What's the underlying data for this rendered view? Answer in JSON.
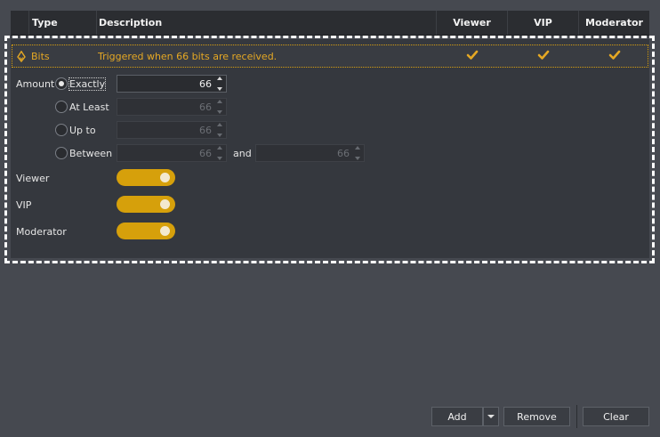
{
  "columns": {
    "type": "Type",
    "description": "Description",
    "viewer": "Viewer",
    "vip": "VIP",
    "moderator": "Moderator"
  },
  "row": {
    "type": "Bits",
    "description": "Triggered when 66 bits are received.",
    "icon": "bits-diamond-icon",
    "viewer_checked": true,
    "vip_checked": true,
    "moderator_checked": true
  },
  "amount": {
    "label": "Amount",
    "options": [
      {
        "label": "Exactly",
        "selected": true,
        "value": "66"
      },
      {
        "label": "At Least",
        "selected": false,
        "value": "66"
      },
      {
        "label": "Up to",
        "selected": false,
        "value": "66"
      },
      {
        "label": "Between",
        "selected": false,
        "value": "66",
        "value2": "66"
      }
    ],
    "and_label": "and"
  },
  "toggles": [
    {
      "label": "Viewer",
      "on": true
    },
    {
      "label": "VIP",
      "on": true
    },
    {
      "label": "Moderator",
      "on": true
    }
  ],
  "buttons": {
    "add": "Add",
    "remove": "Remove",
    "clear": "Clear"
  },
  "colors": {
    "accent": "#d6a00b",
    "accent_text": "#e5a824",
    "background": "#464950",
    "panel": "#35383e"
  }
}
